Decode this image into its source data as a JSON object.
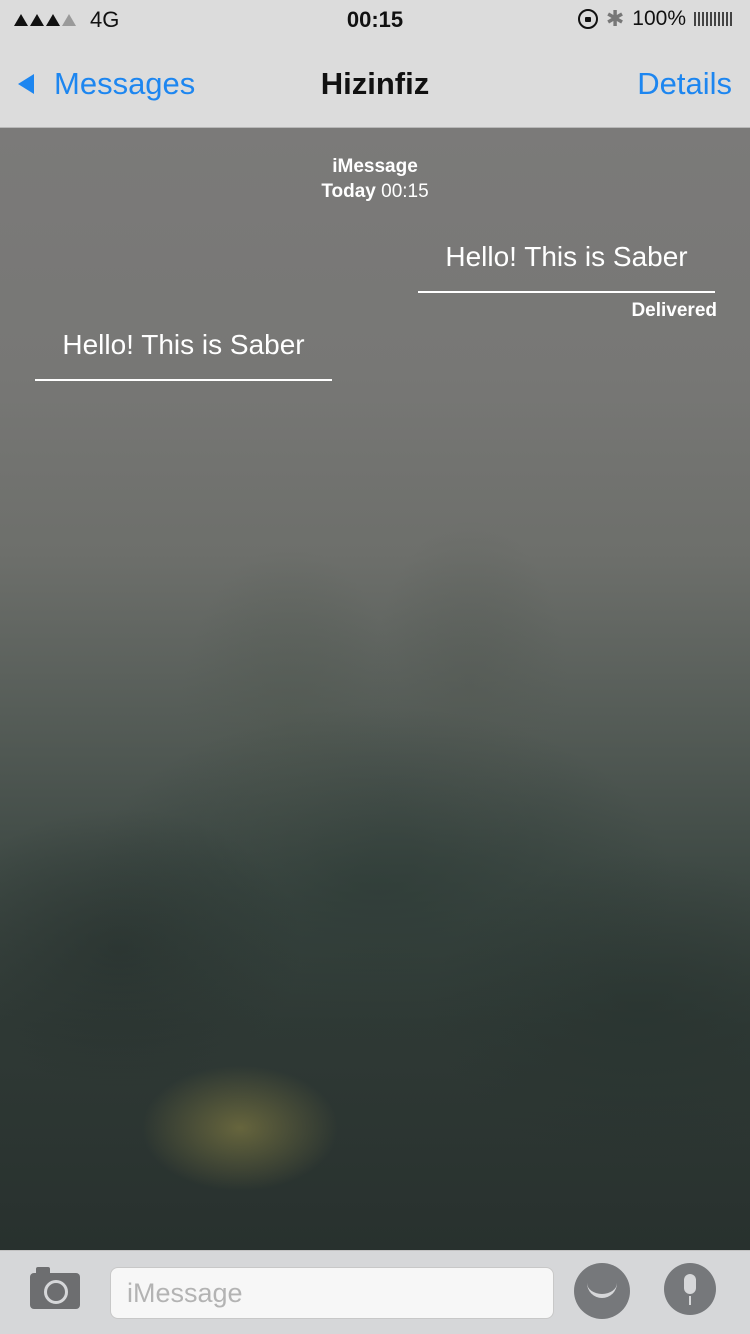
{
  "status_bar": {
    "network": "4G",
    "time": "00:15",
    "battery": "100%",
    "bluetooth_glyph": "✱",
    "icons": [
      "signal-icon",
      "rotation-lock-icon",
      "bluetooth-icon",
      "battery-icon"
    ]
  },
  "nav": {
    "back_label": "Messages",
    "title": "Hizinfiz",
    "details_label": "Details"
  },
  "conversation": {
    "service": "iMessage",
    "day": "Today",
    "time": "00:15",
    "messages": [
      {
        "direction": "outgoing",
        "text": "Hello! This is Saber"
      },
      {
        "direction": "incoming",
        "text": "Hello! This is Saber"
      }
    ],
    "delivered": "Delivered"
  },
  "input_bar": {
    "placeholder": "iMessage",
    "icons": [
      "camera-icon",
      "emoji-icon",
      "microphone-icon"
    ]
  },
  "colors": {
    "accent": "#1d86f0",
    "bar_bg": "#dcdcdc"
  }
}
